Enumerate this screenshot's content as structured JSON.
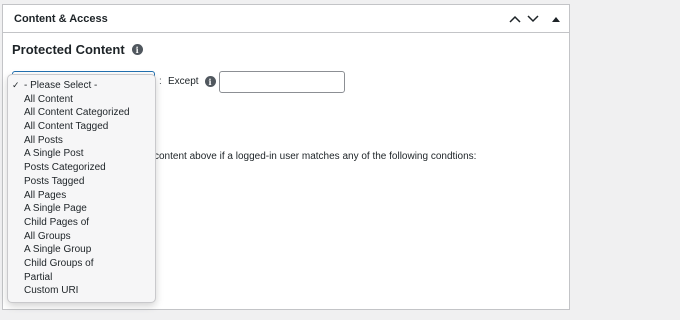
{
  "panel": {
    "title": "Content & Access"
  },
  "section": {
    "title": "Protected Content"
  },
  "rule": {
    "colon": ":",
    "except_label": "Except",
    "except_value": ""
  },
  "conditions_text": "content above if a logged-in user matches any of the following condtions:",
  "dropdown": {
    "selected": "- Please Select -",
    "check": "✓",
    "options": [
      "- Please Select -",
      "All Content",
      "All Content Categorized",
      "All Content Tagged",
      "All Posts",
      "A Single Post",
      "Posts Categorized",
      "Posts Tagged",
      "All Pages",
      "A Single Page",
      "Child Pages of",
      "All Groups",
      "A Single Group",
      "Child Groups of",
      "Partial",
      "Custom URI"
    ]
  },
  "icons": {
    "collapse_up": "chevron-up-icon",
    "collapse_down": "chevron-down-icon",
    "toggle": "triangle-up-icon",
    "info": "info-icon"
  }
}
